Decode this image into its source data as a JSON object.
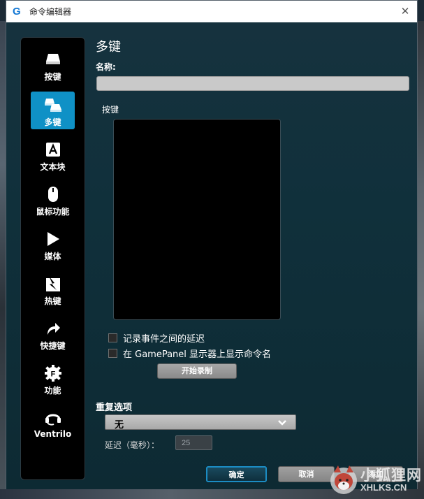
{
  "window": {
    "title": "命令编辑器",
    "logo_letter": "G",
    "close_glyph": "✕"
  },
  "sidebar": {
    "items": [
      {
        "label": "按键",
        "icon": "key-icon"
      },
      {
        "label": "多键",
        "icon": "multikey-icon",
        "active": true
      },
      {
        "label": "文本块",
        "icon": "text-block-icon"
      },
      {
        "label": "鼠标功能",
        "icon": "mouse-icon"
      },
      {
        "label": "媒体",
        "icon": "media-play-icon"
      },
      {
        "label": "热键",
        "icon": "hotkey-icon"
      },
      {
        "label": "快捷键",
        "icon": "shortcut-arrow-icon"
      },
      {
        "label": "功能",
        "icon": "function-gear-icon"
      },
      {
        "label": "Ventrilo",
        "icon": "ventrilo-headset-icon"
      }
    ]
  },
  "main": {
    "title": "多键",
    "name_label": "名称:",
    "name_value": "",
    "keys_label": "按键",
    "checkbox_delay": "记录事件之间的延迟",
    "checkbox_gamepanel": "在 GamePanel 显示器上显示命令名",
    "record_button": "开始录制",
    "repeat_label": "重复选项",
    "repeat_value": "无",
    "delay_label": "延迟（毫秒）：",
    "delay_value": "25"
  },
  "footer": {
    "ok": "确定",
    "cancel": "取消",
    "add": "添加"
  },
  "watermark": {
    "cn": "小狐狸网",
    "en": "XHLKS.CN"
  },
  "colors": {
    "accent": "#0f91c6",
    "panel": "#0f2a35",
    "sidebar": "#000000"
  }
}
